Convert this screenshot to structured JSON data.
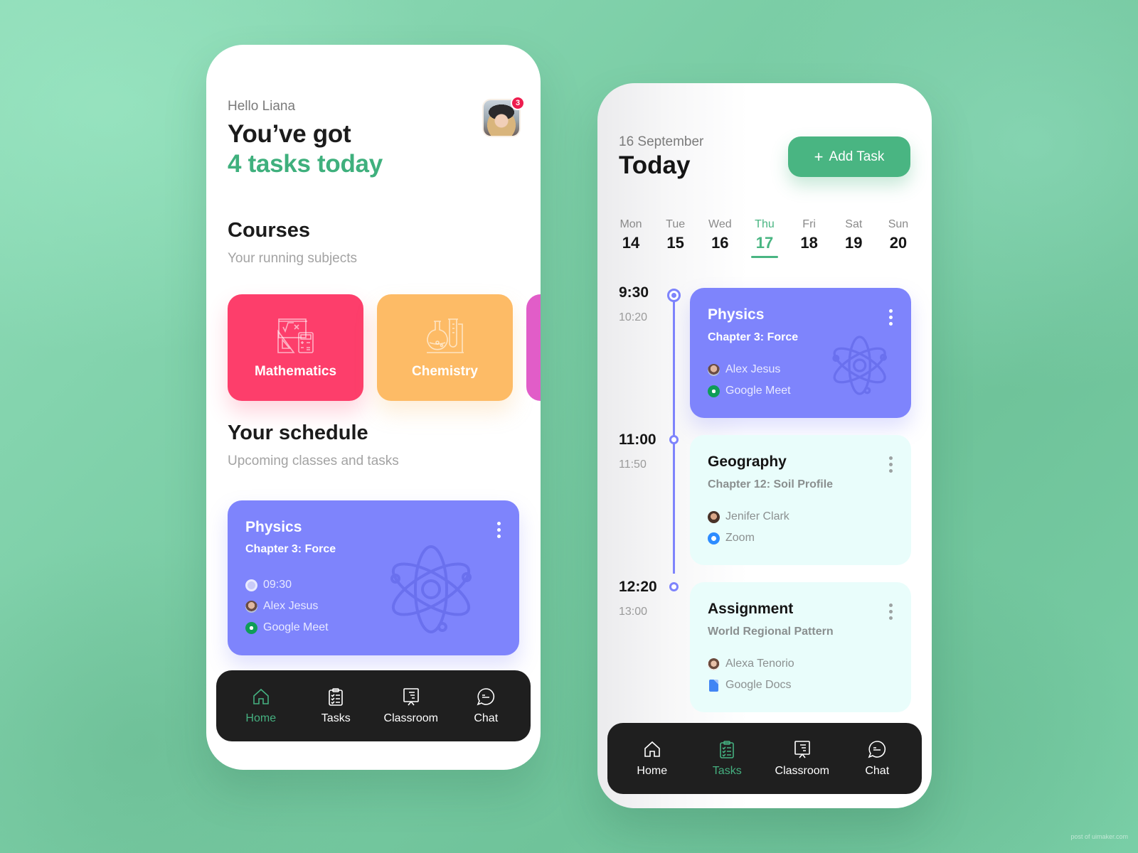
{
  "home": {
    "greeting": "Hello Liana",
    "headline_1": "You’ve got",
    "headline_2": "4 tasks today",
    "notification_count": "3",
    "courses": {
      "title": "Courses",
      "subtitle": "Your running subjects",
      "items": [
        {
          "label": "Mathematics",
          "icon": "math-tools-icon",
          "color": "#fd3e6b"
        },
        {
          "label": "Chemistry",
          "icon": "flask-icon",
          "color": "#fdbb66"
        },
        {
          "label": "",
          "icon": "",
          "color": "#e15dc8"
        }
      ]
    },
    "schedule": {
      "title": "Your schedule",
      "subtitle": "Upcoming classes and tasks",
      "card": {
        "title": "Physics",
        "subtitle": "Chapter 3: Force",
        "time": "09:30",
        "teacher": "Alex Jesus",
        "platform": "Google Meet"
      }
    },
    "nav": [
      {
        "label": "Home",
        "icon": "home-icon",
        "active": true
      },
      {
        "label": "Tasks",
        "icon": "clipboard-icon",
        "active": false
      },
      {
        "label": "Classroom",
        "icon": "presentation-board-icon",
        "active": false
      },
      {
        "label": "Chat",
        "icon": "chat-bubble-icon",
        "active": false
      }
    ]
  },
  "tasks": {
    "date": "16 September",
    "title": "Today",
    "add_button": "Add Task",
    "add_icon": "+",
    "week": [
      {
        "day": "Mon",
        "date": "14",
        "active": false
      },
      {
        "day": "Tue",
        "date": "15",
        "active": false
      },
      {
        "day": "Wed",
        "date": "16",
        "active": false
      },
      {
        "day": "Thu",
        "date": "17",
        "active": true
      },
      {
        "day": "Fri",
        "date": "18",
        "active": false
      },
      {
        "day": "Sat",
        "date": "19",
        "active": false
      },
      {
        "day": "Sun",
        "date": "20",
        "active": false
      }
    ],
    "events": [
      {
        "start": "9:30",
        "end": "10:20",
        "title": "Physics",
        "subtitle": "Chapter 3: Force",
        "person": "Alex Jesus",
        "platform": "Google Meet"
      },
      {
        "start": "11:00",
        "end": "11:50",
        "title": "Geography",
        "subtitle": "Chapter 12: Soil Profile",
        "person": "Jenifer Clark",
        "platform": "Zoom"
      },
      {
        "start": "12:20",
        "end": "13:00",
        "title": "Assignment",
        "subtitle": "World Regional Pattern",
        "person": "Alexa Tenorio",
        "platform": "Google Docs"
      }
    ],
    "nav": [
      {
        "label": "Home",
        "icon": "home-icon",
        "active": false
      },
      {
        "label": "Tasks",
        "icon": "clipboard-icon",
        "active": true
      },
      {
        "label": "Classroom",
        "icon": "presentation-board-icon",
        "active": false
      },
      {
        "label": "Chat",
        "icon": "chat-bubble-icon",
        "active": false
      }
    ]
  },
  "colors": {
    "accent_green": "#49b582",
    "purple": "#7e84fc",
    "math_pink": "#fd3e6b",
    "chem_orange": "#fdbb66",
    "mint_card": "#e9fdfb",
    "nav_dark": "#1f1f1f",
    "badge_red": "#ee1d4e"
  },
  "watermark": "post of uimaker.com"
}
